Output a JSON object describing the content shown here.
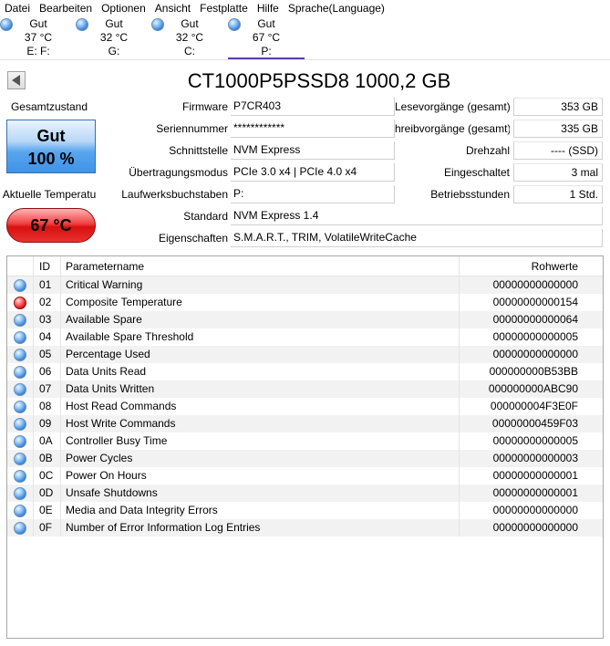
{
  "menu": [
    "Datei",
    "Bearbeiten",
    "Optionen",
    "Ansicht",
    "Festplatte",
    "Hilfe",
    "Sprache(Language)"
  ],
  "drives": [
    {
      "status": "Gut",
      "temp": "37 °C",
      "letters": "E: F:",
      "active": false
    },
    {
      "status": "Gut",
      "temp": "32 °C",
      "letters": "G:",
      "active": false
    },
    {
      "status": "Gut",
      "temp": "32 °C",
      "letters": "C:",
      "active": false
    },
    {
      "status": "Gut",
      "temp": "67 °C",
      "letters": "P:",
      "active": true
    }
  ],
  "disk": {
    "title": "CT1000P5PSSD8 1000,2 GB"
  },
  "health": {
    "label": "Gesamtzustand",
    "status": "Gut",
    "percent": "100 %",
    "color": "#3e92e6"
  },
  "temperature": {
    "label": "Aktuelle Temperatu",
    "value": "67 °C",
    "color": "#d81010"
  },
  "fields": {
    "firmware": {
      "label": "Firmware",
      "value": "P7CR403"
    },
    "serial": {
      "label": "Seriennummer",
      "value": "************"
    },
    "interface": {
      "label": "Schnittstelle",
      "value": "NVM Express"
    },
    "transfer": {
      "label": "Übertragungsmodus",
      "value": "PCIe 3.0 x4 | PCIe 4.0 x4"
    },
    "letters": {
      "label": "Laufwerksbuchstaben",
      "value": "P:"
    },
    "standard": {
      "label": "Standard",
      "value": "NVM Express 1.4"
    },
    "features": {
      "label": "Eigenschaften",
      "value": "S.M.A.R.T., TRIM, VolatileWriteCache"
    },
    "reads": {
      "label": "Lesevorgänge (gesamt)",
      "value": "353 GB"
    },
    "writes": {
      "label": "hreibvorgänge (gesamt)",
      "value": "335 GB"
    },
    "rpm": {
      "label": "Drehzahl",
      "value": "---- (SSD)"
    },
    "power_count": {
      "label": "Eingeschaltet",
      "value": "3 mal"
    },
    "power_hours": {
      "label": "Betriebsstunden",
      "value": "1 Std."
    }
  },
  "table": {
    "headers": {
      "id": "ID",
      "name": "Parametername",
      "raw": "Rohwerte"
    },
    "rows": [
      {
        "id": "01",
        "name": "Critical Warning",
        "raw": "00000000000000",
        "status": "blue"
      },
      {
        "id": "02",
        "name": "Composite Temperature",
        "raw": "00000000000154",
        "status": "red"
      },
      {
        "id": "03",
        "name": "Available Spare",
        "raw": "00000000000064",
        "status": "blue"
      },
      {
        "id": "04",
        "name": "Available Spare Threshold",
        "raw": "00000000000005",
        "status": "blue"
      },
      {
        "id": "05",
        "name": "Percentage Used",
        "raw": "00000000000000",
        "status": "blue"
      },
      {
        "id": "06",
        "name": "Data Units Read",
        "raw": "000000000B53BB",
        "status": "blue"
      },
      {
        "id": "07",
        "name": "Data Units Written",
        "raw": "000000000ABC90",
        "status": "blue"
      },
      {
        "id": "08",
        "name": "Host Read Commands",
        "raw": "000000004F3E0F",
        "status": "blue"
      },
      {
        "id": "09",
        "name": "Host Write Commands",
        "raw": "00000000459F03",
        "status": "blue"
      },
      {
        "id": "0A",
        "name": "Controller Busy Time",
        "raw": "00000000000005",
        "status": "blue"
      },
      {
        "id": "0B",
        "name": "Power Cycles",
        "raw": "00000000000003",
        "status": "blue"
      },
      {
        "id": "0C",
        "name": "Power On Hours",
        "raw": "00000000000001",
        "status": "blue"
      },
      {
        "id": "0D",
        "name": "Unsafe Shutdowns",
        "raw": "00000000000001",
        "status": "blue"
      },
      {
        "id": "0E",
        "name": "Media and Data Integrity Errors",
        "raw": "00000000000000",
        "status": "blue"
      },
      {
        "id": "0F",
        "name": "Number of Error Information Log Entries",
        "raw": "00000000000000",
        "status": "blue"
      }
    ]
  }
}
